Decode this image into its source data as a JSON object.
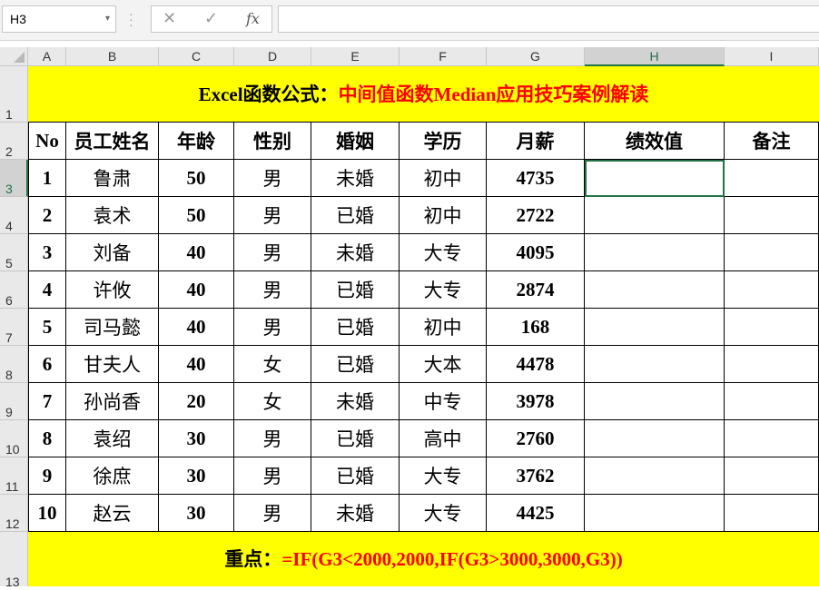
{
  "formula_bar": {
    "name_box": "H3",
    "dropdown_glyph": "▾",
    "cancel_glyph": "✕",
    "enter_glyph": "✓",
    "fx_label": "fx",
    "formula": ""
  },
  "columns": [
    "A",
    "B",
    "C",
    "D",
    "E",
    "F",
    "G",
    "H",
    "I"
  ],
  "rows": [
    "1",
    "2",
    "3",
    "4",
    "5",
    "6",
    "7",
    "8",
    "9",
    "10",
    "11",
    "12",
    "13"
  ],
  "title": {
    "part1": "Excel函数公式：",
    "part2": "中间值函数Median应用技巧案例解读"
  },
  "headers": [
    "No",
    "员工姓名",
    "年龄",
    "性别",
    "婚姻",
    "学历",
    "月薪",
    "绩效值",
    "备注"
  ],
  "records": [
    [
      "1",
      "鲁肃",
      "50",
      "男",
      "未婚",
      "初中",
      "4735",
      "",
      ""
    ],
    [
      "2",
      "袁术",
      "50",
      "男",
      "已婚",
      "初中",
      "2722",
      "",
      ""
    ],
    [
      "3",
      "刘备",
      "40",
      "男",
      "未婚",
      "大专",
      "4095",
      "",
      ""
    ],
    [
      "4",
      "许攸",
      "40",
      "男",
      "已婚",
      "大专",
      "2874",
      "",
      ""
    ],
    [
      "5",
      "司马懿",
      "40",
      "男",
      "已婚",
      "初中",
      "168",
      "",
      ""
    ],
    [
      "6",
      "甘夫人",
      "40",
      "女",
      "已婚",
      "大本",
      "4478",
      "",
      ""
    ],
    [
      "7",
      "孙尚香",
      "20",
      "女",
      "未婚",
      "中专",
      "3978",
      "",
      ""
    ],
    [
      "8",
      "袁绍",
      "30",
      "男",
      "已婚",
      "高中",
      "2760",
      "",
      ""
    ],
    [
      "9",
      "徐庶",
      "30",
      "男",
      "已婚",
      "大专",
      "3762",
      "",
      ""
    ],
    [
      "10",
      "赵云",
      "30",
      "男",
      "未婚",
      "大专",
      "4425",
      "",
      ""
    ]
  ],
  "footer": {
    "part1": "重点：",
    "part2": "=IF(G3<2000,2000,IF(G3>3000,3000,G3))"
  },
  "selection": {
    "cell": "H3",
    "column": "H",
    "row": "3"
  },
  "colors": {
    "band": "#ffff00",
    "accent_red": "#ff0000",
    "excel_green": "#217346"
  }
}
